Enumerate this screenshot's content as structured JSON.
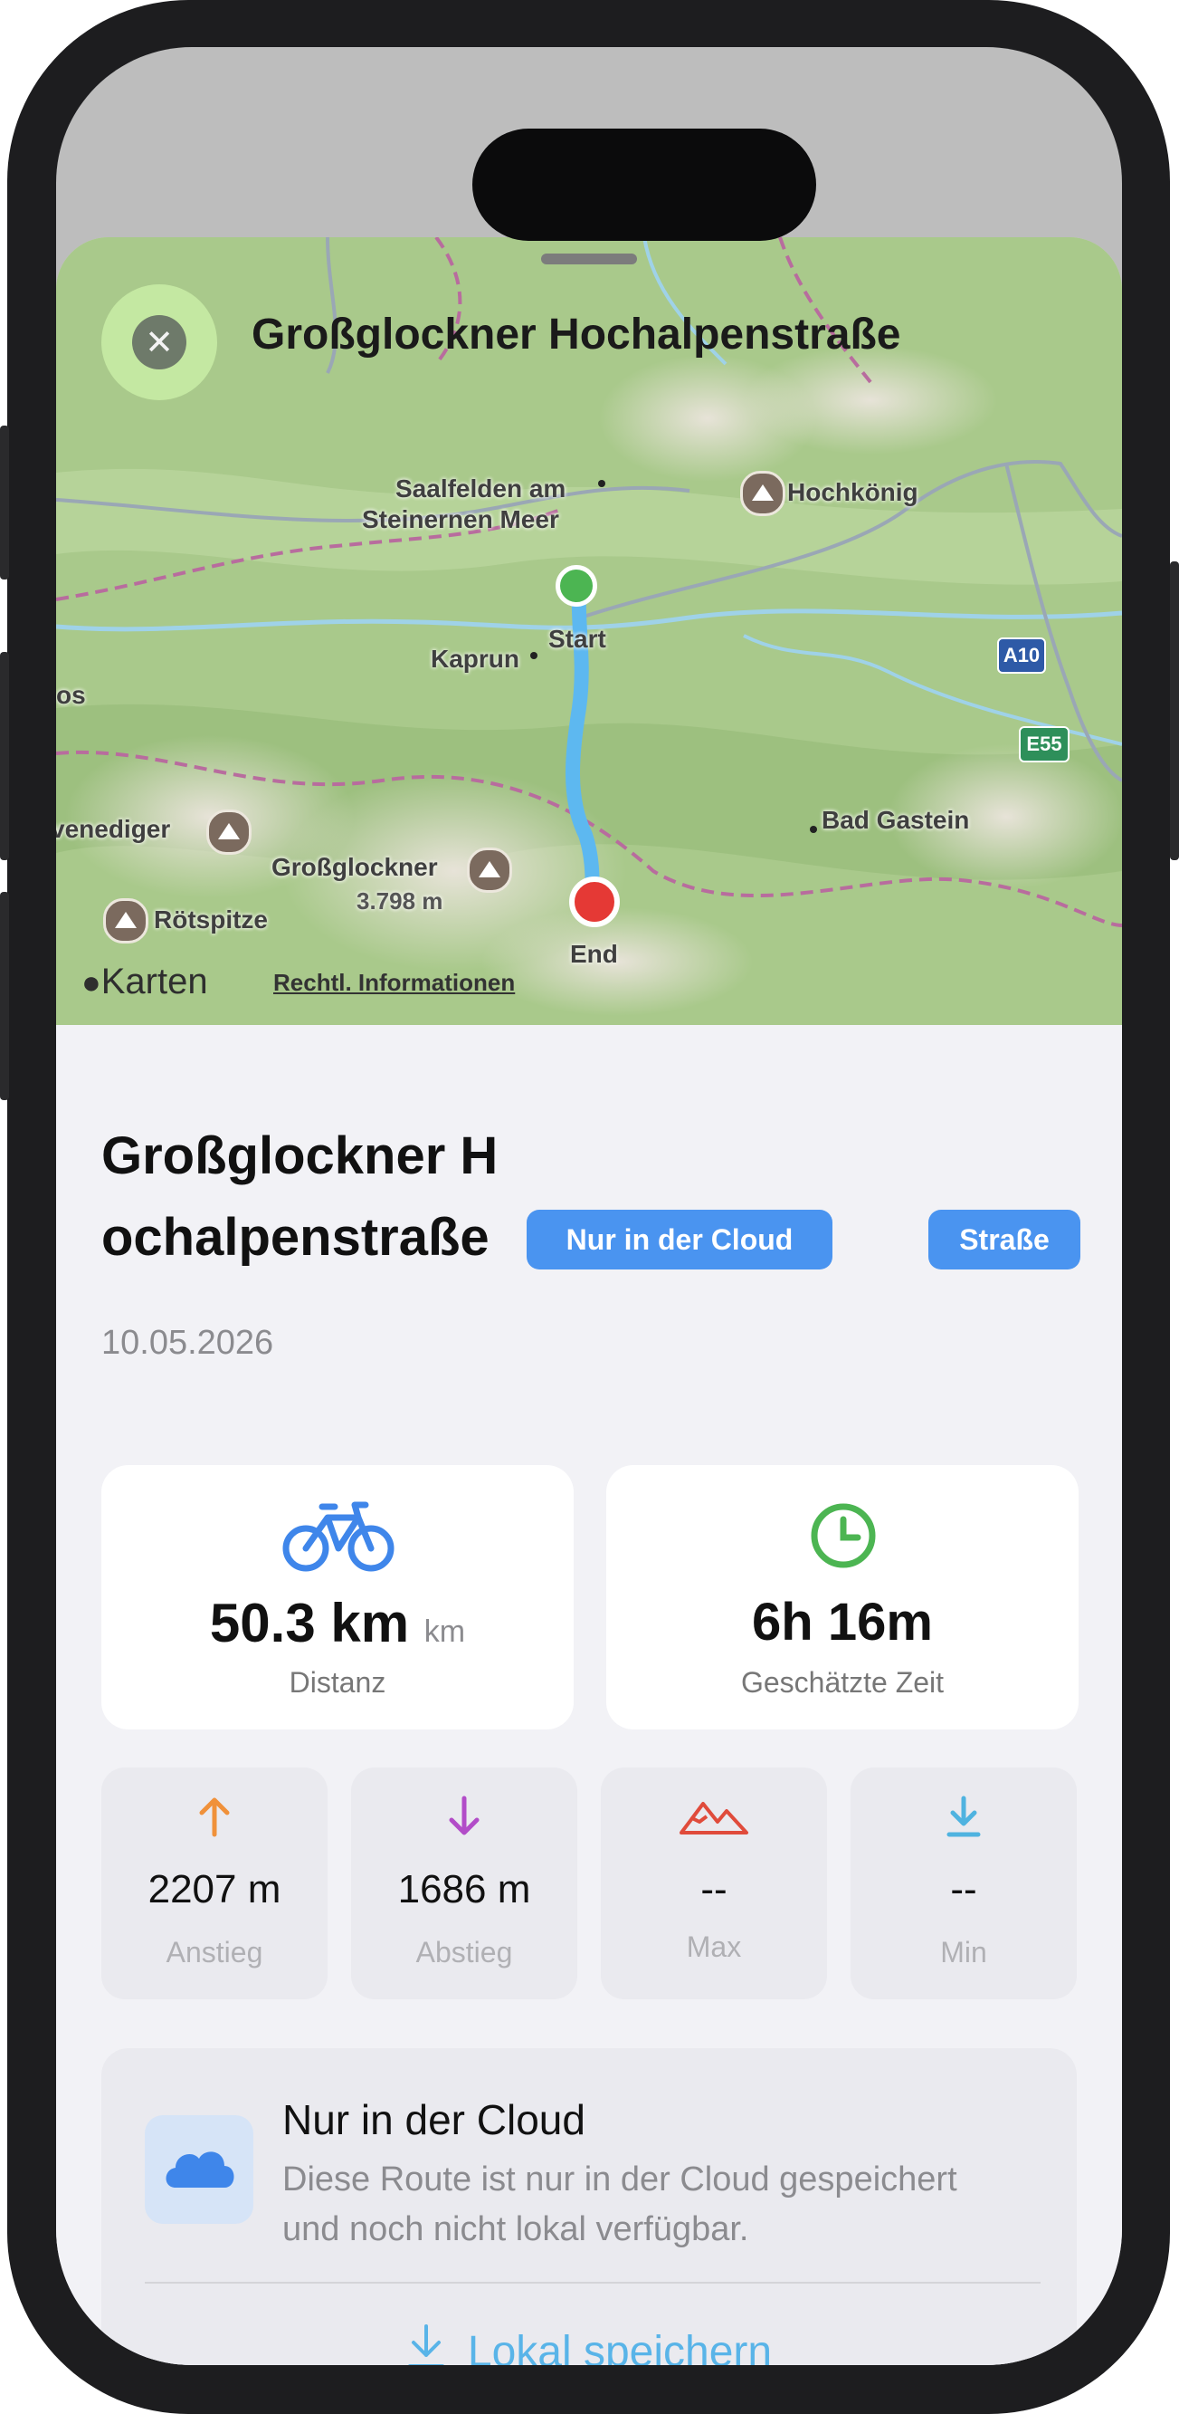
{
  "map": {
    "title": "Großglockner Hochalpenstraße",
    "close_icon": "xmark-icon",
    "labels": {
      "saalfelden_1": "Saalfelden am",
      "saalfelden_2": "Steinernen Meer",
      "hochkoenig": "Hochkönig",
      "kaprun": "Kaprun",
      "start": "Start",
      "bad_gastein": "Bad Gastein",
      "venediger": "venediger",
      "grossglockner": "Großglockner",
      "grossglockner_alt": "3.798 m",
      "roetspitze": "Rötspitze",
      "end": "End",
      "os": "os",
      "a10": "A10",
      "e55": "E55"
    },
    "attribution": "Karten",
    "legal": "Rechtl. Informationen",
    "colors": {
      "start": "#4cb552",
      "end": "#e53935",
      "route": "#5db8f0"
    }
  },
  "route": {
    "title": "Großglockner Hochalpenstraße",
    "badge_cloud": "Nur in der Cloud",
    "badge_type": "Straße",
    "date": "10.05.2026"
  },
  "stats": {
    "distance": {
      "value": "50.3 km",
      "unit": "km",
      "label": "Distanz",
      "icon": "bicycle-icon"
    },
    "time": {
      "value": "6h 16m",
      "label": "Geschätzte Zeit",
      "icon": "clock-icon"
    },
    "ascent": {
      "value": "2207 m",
      "label": "Anstieg",
      "icon": "arrow-up-icon"
    },
    "descent": {
      "value": "1686 m",
      "label": "Abstieg",
      "icon": "arrow-down-icon"
    },
    "max": {
      "value": "--",
      "label": "Max",
      "icon": "mountain-icon"
    },
    "min": {
      "value": "--",
      "label": "Min",
      "icon": "arrow-down-to-line-icon"
    }
  },
  "cloud_notice": {
    "title": "Nur in der Cloud",
    "description": "Diese Route ist nur in der Cloud gespeichert und noch nicht lokal verfügbar.",
    "action": "Lokal speichern",
    "icon": "cloud-icon"
  },
  "colors": {
    "accent": "#4a94f0",
    "ascent": "#f0913a",
    "descent": "#b24cc8",
    "max": "#e04b3b",
    "min": "#4fb3e0",
    "clock": "#4cb552"
  }
}
